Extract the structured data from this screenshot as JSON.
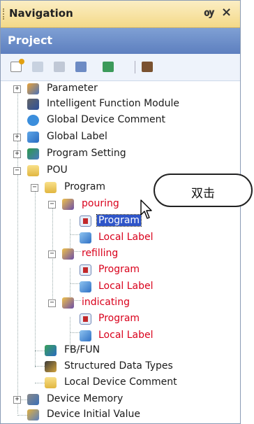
{
  "panel": {
    "title": "Navigation",
    "pin_glyph": "ѹ",
    "close_glyph": "×",
    "section": "Project"
  },
  "toolbar": {
    "icons": [
      "new-item-icon",
      "copy-icon",
      "paste-icon",
      "properties-icon",
      "refresh-icon",
      "find-icon"
    ]
  },
  "tree": {
    "parameter": "Parameter",
    "intelligent": "Intelligent Function Module",
    "global_comment": "Global Device Comment",
    "global_label": "Global Label",
    "program_setting": "Program Setting",
    "pou": "POU",
    "program": "Program",
    "pouring": "pouring",
    "pouring_program": "Program",
    "pouring_local": "Local Label",
    "refilling": "refilling",
    "refilling_program": "Program",
    "refilling_local": "Local Label",
    "indicating": "indicating",
    "indicating_program": "Program",
    "indicating_local": "Local Label",
    "fbfun": "FB/FUN",
    "structured": "Structured Data Types",
    "local_comment": "Local Device Comment",
    "device_memory": "Device Memory",
    "device_initial": "Device Initial Value"
  },
  "callout": {
    "text": "双击"
  },
  "colors": {
    "title_bg": "#f4d988",
    "project_bar": "#6a8cc8",
    "selection": "#2f55c9",
    "red_text": "#d9001b"
  }
}
